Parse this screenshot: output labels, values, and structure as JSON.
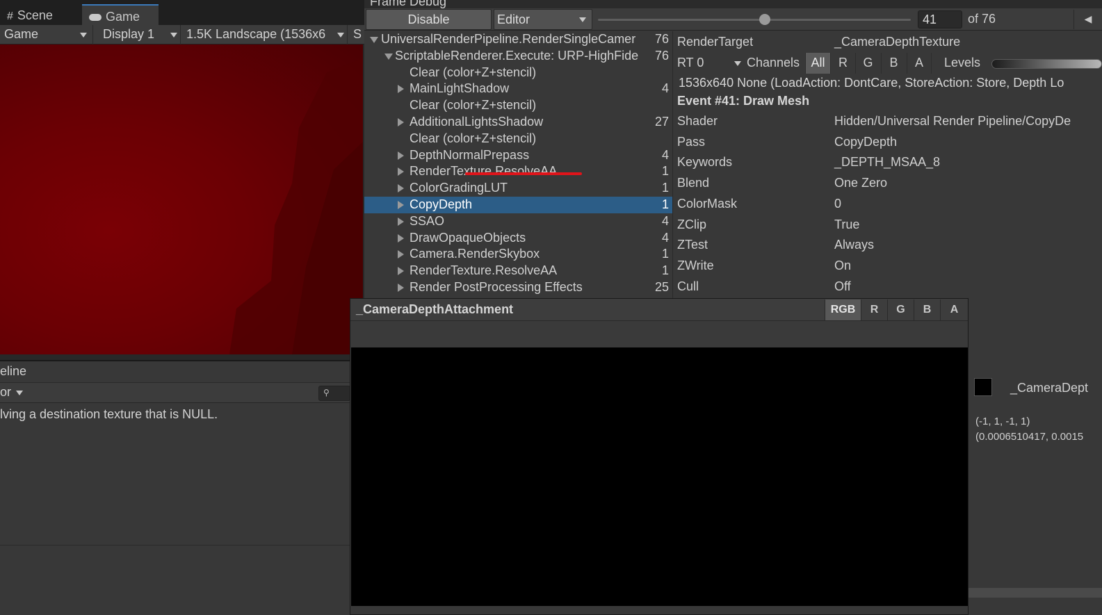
{
  "game": {
    "tabs": [
      {
        "label": "Scene",
        "icon": "grid-hash-icon"
      },
      {
        "label": "Game",
        "icon": "gamepad-icon"
      }
    ],
    "toolbar": {
      "mode": "Game",
      "display": "Display 1",
      "resolution": "1.5K Landscape (1536x6",
      "scale_prefix": "S"
    },
    "viewport_color": "#6b0004"
  },
  "console": {
    "title": "eline",
    "filter": "or",
    "search_icon": "search-icon",
    "message": "lving a destination texture that is NULL."
  },
  "frame_debug": {
    "title": "Frame Debug",
    "disable_label": "Disable",
    "target_label": "Editor",
    "event_value": "41",
    "event_total": "of 76",
    "slider_fraction": 0.533,
    "tree": [
      {
        "label": "UniversalRenderPipeline.RenderSingleCamer",
        "count": "76",
        "depth": 0,
        "arrow": "open"
      },
      {
        "label": "ScriptableRenderer.Execute: URP-HighFide",
        "count": "76",
        "depth": 1,
        "arrow": "open"
      },
      {
        "label": "Clear (color+Z+stencil)",
        "count": "",
        "depth": 2,
        "arrow": "none"
      },
      {
        "label": "MainLightShadow",
        "count": "4",
        "depth": 2,
        "arrow": "closed"
      },
      {
        "label": "Clear (color+Z+stencil)",
        "count": "",
        "depth": 2,
        "arrow": "none"
      },
      {
        "label": "AdditionalLightsShadow",
        "count": "27",
        "depth": 2,
        "arrow": "closed"
      },
      {
        "label": "Clear (color+Z+stencil)",
        "count": "",
        "depth": 2,
        "arrow": "none"
      },
      {
        "label": "DepthNormalPrepass",
        "count": "4",
        "depth": 2,
        "arrow": "closed"
      },
      {
        "label": "RenderTexture.ResolveAA",
        "count": "1",
        "depth": 2,
        "arrow": "closed"
      },
      {
        "label": "ColorGradingLUT",
        "count": "1",
        "depth": 2,
        "arrow": "closed"
      },
      {
        "label": "CopyDepth",
        "count": "1",
        "depth": 2,
        "arrow": "closed",
        "selected": true
      },
      {
        "label": "SSAO",
        "count": "4",
        "depth": 2,
        "arrow": "closed"
      },
      {
        "label": "DrawOpaqueObjects",
        "count": "4",
        "depth": 2,
        "arrow": "closed"
      },
      {
        "label": "Camera.RenderSkybox",
        "count": "1",
        "depth": 2,
        "arrow": "closed"
      },
      {
        "label": "RenderTexture.ResolveAA",
        "count": "1",
        "depth": 2,
        "arrow": "closed"
      },
      {
        "label": "Render PostProcessing Effects",
        "count": "25",
        "depth": 2,
        "arrow": "closed"
      }
    ],
    "details": {
      "render_target_label": "RenderTarget",
      "render_target_value": "_CameraDepthTexture",
      "rt_index": "RT 0",
      "channels_label": "Channels",
      "channel_buttons": [
        "All",
        "R",
        "G",
        "B",
        "A"
      ],
      "levels_label": "Levels",
      "rt_info": "1536x640 None (LoadAction: DontCare, StoreAction: Store, Depth Lo",
      "event_title": "Event #41: Draw Mesh",
      "properties": [
        {
          "key": "Shader",
          "value": "Hidden/Universal Render Pipeline/CopyDe"
        },
        {
          "key": "Pass",
          "value": "CopyDepth"
        },
        {
          "key": "Keywords",
          "value": "_DEPTH_MSAA_8"
        },
        {
          "key": "Blend",
          "value": "One Zero"
        },
        {
          "key": "ColorMask",
          "value": "0"
        },
        {
          "key": "ZClip",
          "value": "True"
        },
        {
          "key": "ZTest",
          "value": "Always"
        },
        {
          "key": "ZWrite",
          "value": "On"
        },
        {
          "key": "Cull",
          "value": "Off"
        }
      ],
      "highlight_color": "#e0141a"
    }
  },
  "texture_preview": {
    "name": "_CameraDepthAttachment",
    "channel_buttons": [
      "RGB",
      "R",
      "G",
      "B",
      "A"
    ],
    "image_color": "#000000"
  },
  "right_strip": {
    "swatch_label": "_CameraDept",
    "coord1": "(-1, 1, -1, 1)",
    "coord2": "(0.0006510417, 0.0015"
  }
}
